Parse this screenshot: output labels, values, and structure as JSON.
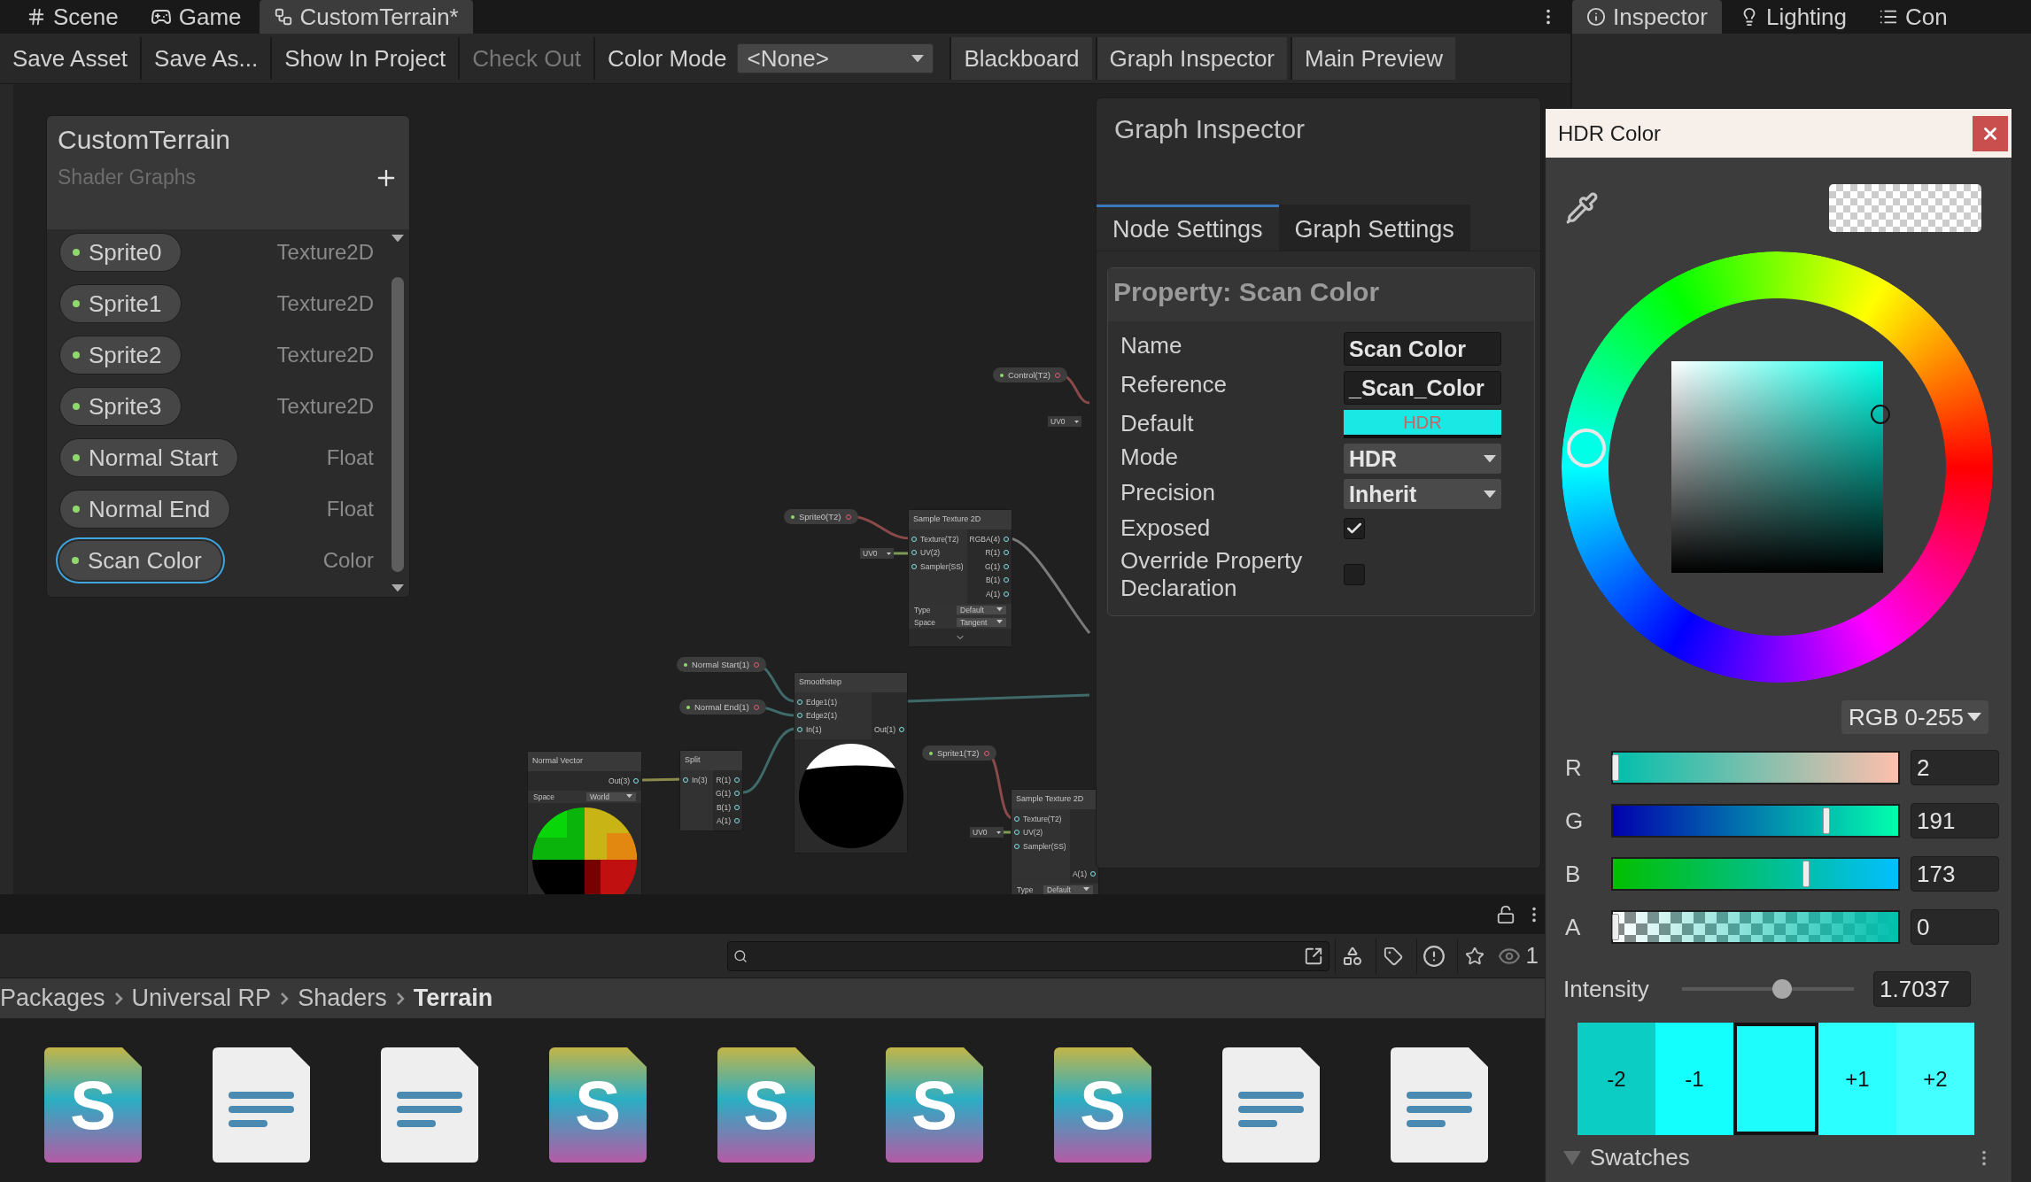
{
  "editor_tabs": [
    {
      "kind": "scene",
      "label": "Scene",
      "selected": false
    },
    {
      "kind": "game",
      "label": "Game",
      "selected": false
    },
    {
      "kind": "graph",
      "label": "CustomTerrain*",
      "selected": true
    }
  ],
  "side_tabs": [
    {
      "kind": "inspector",
      "label": "Inspector",
      "selected": true
    },
    {
      "kind": "lighting",
      "label": "Lighting",
      "selected": false
    },
    {
      "kind": "console",
      "label": "Con",
      "selected": false
    }
  ],
  "toolbar": {
    "buttons": [
      {
        "label": "Save Asset",
        "disabled": false
      },
      {
        "label": "Save As...",
        "disabled": false
      },
      {
        "label": "Show In Project",
        "disabled": false
      },
      {
        "label": "Check Out",
        "disabled": true
      }
    ],
    "color_mode": {
      "label": "Color Mode",
      "value": "<None>"
    },
    "panel_toggles": [
      "Blackboard",
      "Graph Inspector",
      "Main Preview"
    ]
  },
  "blackboard": {
    "title": "CustomTerrain",
    "subtitle": "Shader Graphs",
    "properties": [
      {
        "name": "Sprite0",
        "type": "Texture2D",
        "selected": false
      },
      {
        "name": "Sprite1",
        "type": "Texture2D",
        "selected": false
      },
      {
        "name": "Sprite2",
        "type": "Texture2D",
        "selected": false
      },
      {
        "name": "Sprite3",
        "type": "Texture2D",
        "selected": false
      },
      {
        "name": "Normal Start",
        "type": "Float",
        "selected": false
      },
      {
        "name": "Normal End",
        "type": "Float",
        "selected": false
      },
      {
        "name": "Scan Color",
        "type": "Color",
        "selected": true
      }
    ]
  },
  "graph": {
    "property_nodes": [
      {
        "label": "Control(T2)"
      },
      {
        "label": "Sprite0(T2)"
      },
      {
        "label": "Normal Start(1)"
      },
      {
        "label": "Normal End(1)"
      },
      {
        "label": "Sprite1(T2)"
      }
    ],
    "uv_inputs": [
      "UV0",
      "UV0",
      "UV0"
    ],
    "nodes": [
      {
        "title": "Sample Texture 2D",
        "inputs": [
          "Texture(T2)",
          "UV(2)",
          "Sampler(SS)"
        ],
        "outputs": [
          "RGBA(4)",
          "R(1)",
          "G(1)",
          "B(1)",
          "A(1)"
        ],
        "settings": [
          {
            "label": "Type",
            "value": "Default"
          },
          {
            "label": "Space",
            "value": "Tangent"
          }
        ],
        "collapsible": true
      },
      {
        "title": "Smoothstep",
        "inputs": [
          "Edge1(1)",
          "Edge2(1)",
          "In(1)"
        ],
        "outputs": [
          "Out(1)"
        ],
        "preview": {
          "kind": "mask"
        }
      },
      {
        "title": "Normal Vector",
        "outputs": [
          "Out(3)"
        ],
        "settings": [
          {
            "label": "Space",
            "value": "World"
          }
        ],
        "preview": {
          "kind": "normals"
        }
      },
      {
        "title": "Split",
        "inputs": [
          "In(3)"
        ],
        "outputs": [
          "R(1)",
          "G(1)",
          "B(1)",
          "A(1)"
        ]
      },
      {
        "title": "Sample Texture 2D",
        "inputs": [
          "Texture(T2)",
          "UV(2)",
          "Sampler(SS)"
        ],
        "outputs": [
          "A(1)"
        ],
        "settings": [
          {
            "label": "Type",
            "value": "Default"
          }
        ]
      }
    ]
  },
  "graph_inspector": {
    "title": "Graph Inspector",
    "tabs": [
      {
        "label": "Node Settings",
        "selected": true
      },
      {
        "label": "Graph Settings",
        "selected": false
      }
    ],
    "section_title": "Property: Scan Color",
    "fields": [
      {
        "kind": "text",
        "label": "Name",
        "value": "Scan Color"
      },
      {
        "kind": "text",
        "label": "Reference",
        "value": "_Scan_Color"
      },
      {
        "kind": "color",
        "label": "Default",
        "value": "HDR",
        "color": "#1ae8e4"
      },
      {
        "kind": "dropdown",
        "label": "Mode",
        "value": "HDR"
      },
      {
        "kind": "dropdown",
        "label": "Precision",
        "value": "Inherit"
      },
      {
        "kind": "checkbox",
        "label": "Exposed",
        "checked": true
      },
      {
        "kind": "checkbox",
        "label": "Override Property Declaration",
        "checked": false
      }
    ]
  },
  "color_picker": {
    "title": "HDR Color",
    "mode": "RGB 0-255",
    "channels": [
      {
        "name": "R",
        "value": "2",
        "level": 0.008
      },
      {
        "name": "G",
        "value": "191",
        "level": 0.749
      },
      {
        "name": "B",
        "value": "173",
        "level": 0.678
      },
      {
        "name": "A",
        "value": "0",
        "level": 0
      }
    ],
    "intensity": {
      "label": "Intensity",
      "value": "1.7037",
      "level": 0.58
    },
    "exposure_steps": [
      {
        "label": "-2",
        "color": "#0ccdc4",
        "selected": false
      },
      {
        "label": "-1",
        "color": "#12fffd",
        "selected": false
      },
      {
        "color": "#1cfdfc",
        "selected": true
      },
      {
        "label": "+1",
        "color": "#2bffff",
        "selected": false
      },
      {
        "label": "+2",
        "color": "#44ffff",
        "selected": false
      }
    ],
    "swatches": {
      "label": "Swatches",
      "expanded": true
    }
  },
  "project": {
    "breadcrumb": [
      {
        "label": "Packages",
        "current": false
      },
      {
        "label": "Universal RP",
        "current": false
      },
      {
        "label": "Shaders",
        "current": false
      },
      {
        "label": "Terrain",
        "current": true
      }
    ],
    "filter_count": "1",
    "assets": [
      {
        "kind": "shader",
        "glyph": "S"
      },
      {
        "kind": "text"
      },
      {
        "kind": "text"
      },
      {
        "kind": "shader",
        "glyph": "S"
      },
      {
        "kind": "shader",
        "glyph": "S"
      },
      {
        "kind": "shader",
        "glyph": "S"
      },
      {
        "kind": "shader",
        "glyph": "S"
      },
      {
        "kind": "text"
      },
      {
        "kind": "text"
      }
    ]
  }
}
